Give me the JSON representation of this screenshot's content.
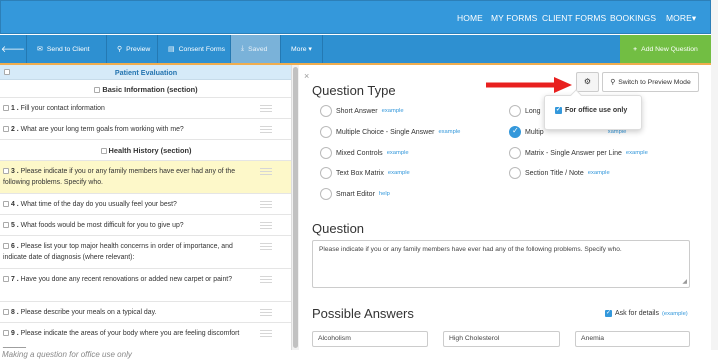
{
  "topnav": {
    "links": [
      "HOME",
      "MY FORMS",
      "CLIENT FORMS",
      "BOOKINGS",
      "MORE▾"
    ]
  },
  "toolbar": {
    "back_icon": "arrow-left-icon",
    "send_label": "Send to Client",
    "preview_label": "Preview",
    "consent_label": "Consent Forms",
    "saved_label": "Saved",
    "more_label": "More ▾",
    "add_label": "Add New Question"
  },
  "left": {
    "title": "Patient Evaluation",
    "rows": [
      {
        "kind": "section",
        "text": "Basic Information (section)"
      },
      {
        "kind": "q",
        "num": "1 .",
        "text": "Fill your contact information"
      },
      {
        "kind": "q",
        "num": "2 .",
        "text": "What are your long term goals from working with me?"
      },
      {
        "kind": "section",
        "text": "Health History (section)"
      },
      {
        "kind": "q",
        "num": "3 .",
        "text": "Please indicate if you or any family members have ever had any of the following problems. Specify who."
      },
      {
        "kind": "q",
        "num": "4 .",
        "text": "What time of the day do you usually feel your best?"
      },
      {
        "kind": "q",
        "num": "5 .",
        "text": "What foods would be most difficult for you to give up?"
      },
      {
        "kind": "q",
        "num": "6 .",
        "text": "Please list your top major health concerns in order of importance, and indicate date of diagnosis (where relevant):"
      },
      {
        "kind": "q",
        "num": "7 .",
        "text": "Have you done any recent renovations or added new carpet or paint?"
      },
      {
        "kind": "q",
        "num": "8 .",
        "text": "Please describe your meals on a typical day."
      },
      {
        "kind": "q",
        "num": "9 .",
        "text": "Please indicate the areas of your body where you are feeling discomfort ______"
      }
    ]
  },
  "right": {
    "question_type_heading": "Question Type",
    "preview_mode_label": "Switch to Preview Mode",
    "popup_label": "For office use only",
    "types": [
      {
        "label": "Short Answer",
        "link": "example"
      },
      {
        "label": "Long",
        "link": ""
      },
      {
        "label": "Multiple Choice - Single Answer",
        "link": "example"
      },
      {
        "label": "Multip",
        "link": "xample"
      },
      {
        "label": "Mixed Controls",
        "link": "example"
      },
      {
        "label": "Matrix - Single Answer per Line",
        "link": "example"
      },
      {
        "label": "Text Box Matrix",
        "link": "example"
      },
      {
        "label": "Section Title / Note",
        "link": "example"
      },
      {
        "label": "Smart Editor",
        "link": "help"
      }
    ],
    "question_heading": "Question",
    "question_text": "Please indicate if you or any family members have ever had any of the following problems. Specify who.",
    "answers_heading": "Possible Answers",
    "ask_details_label": "Ask for details",
    "ask_details_link": "(example)",
    "answers": [
      "Alcoholism",
      "High Cholesterol",
      "Anemia"
    ]
  },
  "caption": "Making a question for office use only"
}
